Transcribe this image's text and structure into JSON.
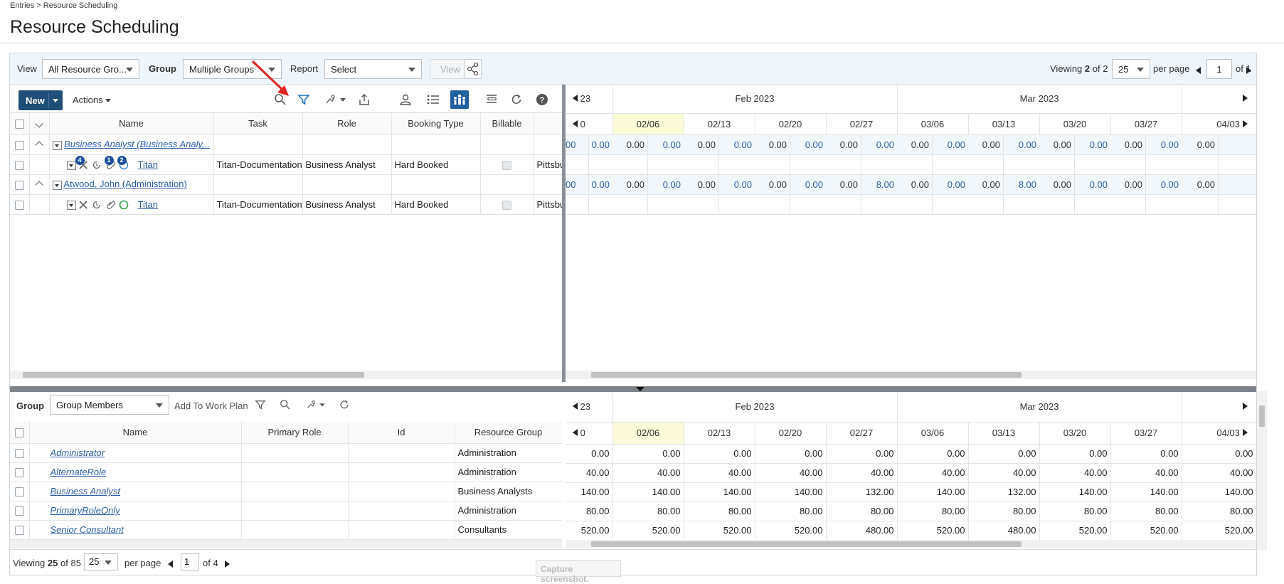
{
  "breadcrumb": "Entries > Resource Scheduling",
  "page_title": "Resource Scheduling",
  "viewbar": {
    "view_label": "View",
    "view_value": "All Resource Gro...",
    "group_label": "Group",
    "group_value": "Multiple Groups",
    "report_label": "Report",
    "report_value": "Select",
    "view_button": "View",
    "viewing_prefix": "Viewing",
    "viewing_current": "2",
    "viewing_of": "of 2",
    "per_page_value": "25",
    "per_page_label": "per page",
    "page_value": "1",
    "page_of": "of 1"
  },
  "toolbar": {
    "new_label": "New",
    "actions_label": "Actions"
  },
  "top_grid": {
    "columns": [
      "Name",
      "Task",
      "Role",
      "Booking Type",
      "Billable"
    ],
    "rows": [
      {
        "name": "Business Analyst (Business Analy...",
        "type": "group"
      },
      {
        "name": "Titan",
        "task": "Titan-Documentation",
        "role": "Business Analyst",
        "booking": "Hard Booked",
        "location": "Pittsburg",
        "badges": [
          "4",
          "1",
          "2"
        ]
      },
      {
        "name": "Atwood, John (Administration)",
        "type": "group"
      },
      {
        "name": "Titan",
        "task": "Titan-Documentation",
        "role": "Business Analyst",
        "booking": "Hard Booked",
        "location": "Pittsburg"
      }
    ]
  },
  "calendar": {
    "partial_month": "23",
    "months": [
      "Feb 2023",
      "Mar 2023"
    ],
    "partial_week": "0",
    "weeks": [
      "02/06",
      "02/13",
      "02/20",
      "02/27",
      "03/06",
      "03/13",
      "03/20",
      "03/27",
      "04/03"
    ],
    "top_rows": [
      [
        "00",
        "0.00",
        "0.00",
        "0.00",
        "0.00",
        "0.00",
        "0.00",
        "0.00",
        "0.00",
        "0.00",
        "0.00",
        "0.00",
        "0.00",
        "0.00",
        "0.00",
        "0.00",
        "0.00",
        "0.00",
        "0.00"
      ],
      [],
      [
        "00",
        "0.00",
        "0.00",
        "0.00",
        "0.00",
        "0.00",
        "0.00",
        "0.00",
        "0.00",
        "8.00",
        "0.00",
        "0.00",
        "0.00",
        "8.00",
        "0.00",
        "0.00",
        "0.00",
        "0.00",
        "0.00"
      ],
      []
    ]
  },
  "bottom": {
    "group_label": "Group",
    "group_value": "Group Members",
    "add_to_work_plan": "Add To Work Plan",
    "columns": [
      "Name",
      "Primary Role",
      "Id",
      "Resource Group"
    ],
    "rows": [
      {
        "name": "Administrator",
        "resource_group": "Administration",
        "values": [
          "0.00",
          "0.00",
          "0.00",
          "0.00",
          "0.00",
          "0.00",
          "0.00",
          "0.00",
          "0.00",
          "0.00"
        ]
      },
      {
        "name": "AlternateRole",
        "resource_group": "Administration",
        "values": [
          "40.00",
          "40.00",
          "40.00",
          "40.00",
          "40.00",
          "40.00",
          "40.00",
          "40.00",
          "40.00",
          "40.00"
        ]
      },
      {
        "name": "Business Analyst",
        "resource_group": "Business Analysts",
        "values": [
          "140.00",
          "140.00",
          "140.00",
          "140.00",
          "132.00",
          "140.00",
          "132.00",
          "140.00",
          "140.00",
          "140.00"
        ]
      },
      {
        "name": "PrimaryRoleOnly",
        "resource_group": "Administration",
        "values": [
          "80.00",
          "80.00",
          "80.00",
          "80.00",
          "80.00",
          "80.00",
          "80.00",
          "80.00",
          "80.00",
          "80.00"
        ]
      },
      {
        "name": "Senior Consultant",
        "resource_group": "Consultants",
        "values": [
          "520.00",
          "520.00",
          "520.00",
          "520.00",
          "480.00",
          "520.00",
          "480.00",
          "520.00",
          "520.00",
          "520.00"
        ]
      }
    ]
  },
  "footer": {
    "viewing_prefix": "Viewing",
    "viewing_current": "25",
    "viewing_of": "of 85",
    "per_page_value": "25",
    "per_page_label": "per page",
    "page_value": "1",
    "page_of": "of 4"
  },
  "capture_label": "Capture screenshot.",
  "colors": {
    "accent": "#1f4e79",
    "link": "#2b5fa8",
    "annotation_arrow": "#e32020",
    "highlight_week": "#fbfbd8"
  }
}
